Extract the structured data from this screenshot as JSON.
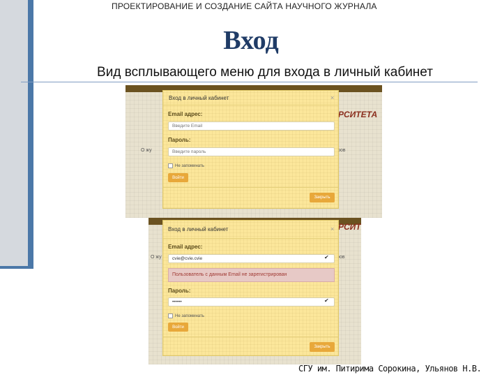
{
  "slide": {
    "header": "ПРОЕКТИРОВАНИЕ И СОЗДАНИЕ САЙТА НАУЧНОГО ЖУРНАЛА",
    "title": "Вход",
    "subtitle": "Вид всплывающего меню для входа в личный кабинет",
    "footer": "СГУ им. Питирима Сорокина, Ульянов Н.В.",
    "accent_color": "#4b78a8"
  },
  "screenshot1": {
    "bg_logo_text": "РСИТЕТА",
    "bg_side_text_left": "О жу",
    "bg_side_text_right": "ров",
    "modal": {
      "title": "Вход в личный кабинет",
      "close": "×",
      "email_label": "Email адрес:",
      "email_placeholder": "Введите Email",
      "password_label": "Пароль:",
      "password_placeholder": "Введите пароль",
      "remember_label": "Не запоминать",
      "login_button": "Войти",
      "close_button": "Закрыть"
    }
  },
  "screenshot2": {
    "bg_logo_text": "РСИТЕТА",
    "bg_side_text_left": "О жу",
    "bg_side_text_right": "ров",
    "modal": {
      "title": "Вход в личный кабинет",
      "close": "×",
      "email_label": "Email адрес:",
      "email_value": "cvie@cvie.cvie",
      "error_message": "Пользователь с данным Email не зарегистрирован",
      "password_label": "Пароль:",
      "password_value": "••••••",
      "remember_label": "Не запоминать",
      "login_button": "Войти",
      "close_button": "Закрыть"
    }
  }
}
